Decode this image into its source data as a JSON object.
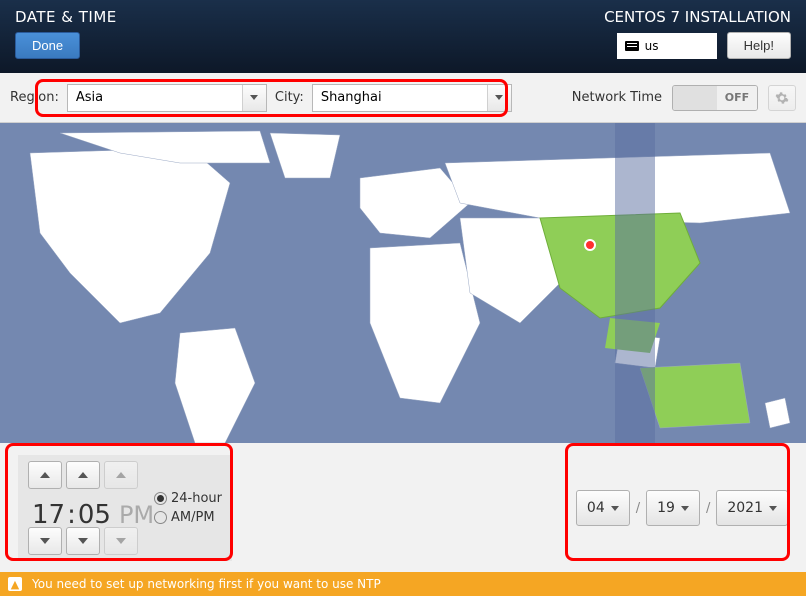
{
  "header": {
    "title": "DATE & TIME",
    "installer_title": "CENTOS 7 INSTALLATION",
    "done_label": "Done",
    "help_label": "Help!",
    "keyboard_layout": "us"
  },
  "toolbar": {
    "region_label": "Region:",
    "region_value": "Asia",
    "city_label": "City:",
    "city_value": "Shanghai",
    "network_time_label": "Network Time",
    "network_time_state": "OFF"
  },
  "time": {
    "hour": "17",
    "minute": "05",
    "ampm_label": "PM",
    "format_24_label": "24-hour",
    "format_ampm_label": "AM/PM",
    "format_selected": "24-hour"
  },
  "date": {
    "month": "04",
    "day": "19",
    "year": "2021",
    "separator": "/"
  },
  "status": {
    "message": "You need to set up networking first if you want to use NTP"
  },
  "map": {
    "selected_location": "Shanghai",
    "selected_region_highlight": "China"
  }
}
